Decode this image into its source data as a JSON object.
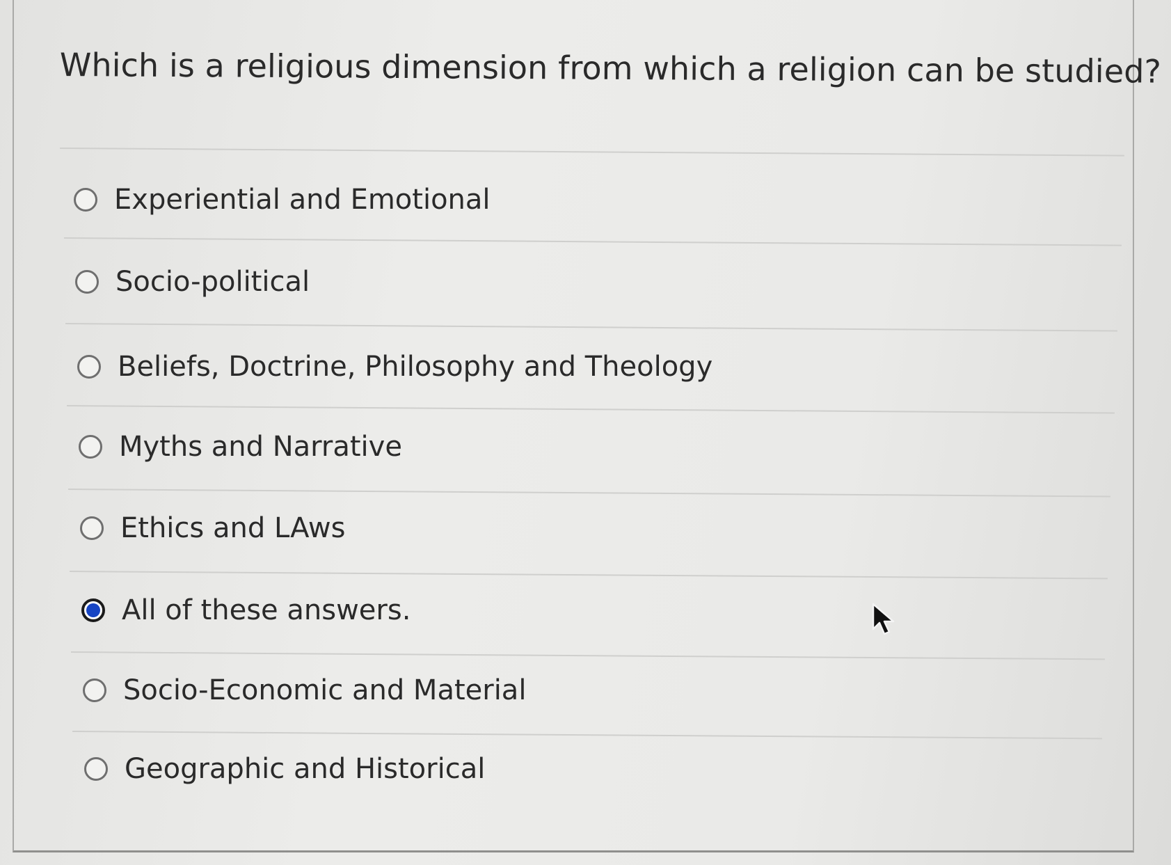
{
  "question": {
    "text": "Which is a religious dimension from which a religion can be studied?"
  },
  "answers": [
    {
      "label": "Experiential and Emotional",
      "selected": false
    },
    {
      "label": "Socio-political",
      "selected": false
    },
    {
      "label": "Beliefs, Doctrine, Philosophy and Theology",
      "selected": false
    },
    {
      "label": "Myths and Narrative",
      "selected": false
    },
    {
      "label": "Ethics and LAws",
      "selected": false
    },
    {
      "label": "All of these answers.",
      "selected": true
    },
    {
      "label": "Socio-Economic and Material",
      "selected": false
    },
    {
      "label": "Geographic and Historical",
      "selected": false
    }
  ],
  "colors": {
    "selected_radio": "#1745c4",
    "text": "#2a2a2a",
    "divider": "#cfcfcd"
  },
  "icons": {
    "cursor": "mouse-pointer-icon"
  }
}
